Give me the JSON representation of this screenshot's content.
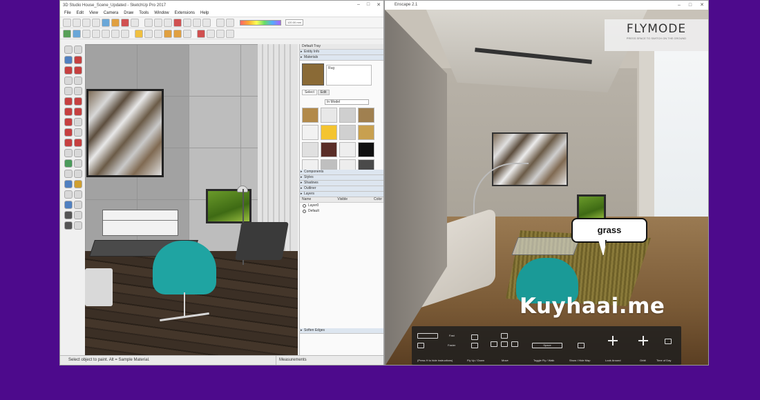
{
  "sketchup": {
    "title": "3D Studio House_Scene_Updated - SketchUp Pro 2017",
    "menu": [
      "File",
      "Edit",
      "View",
      "Camera",
      "Draw",
      "Tools",
      "Window",
      "Extensions",
      "Help"
    ],
    "field_label": "120.00 mm",
    "tray": {
      "title": "Default Tray",
      "entity_info": "Entity Info",
      "materials": "Materials",
      "material_name": "Rug",
      "tabs": [
        "Select",
        "Edit"
      ],
      "category": "In Model",
      "swatch_colors": [
        "#b28a4a",
        "#e8e8e8",
        "#cfcfcf",
        "#a08050",
        "#f2f2f2",
        "#f4c430",
        "#d0d0d0",
        "#c8a050",
        "#e0e0e0",
        "#5a2e28",
        "#eeeeee",
        "#111111",
        "#f0f0f0",
        "#bfbfbf",
        "#ededed",
        "#4a4a4a"
      ],
      "sections": [
        "Components",
        "Styles",
        "Shadows",
        "Outliner",
        "Layers"
      ],
      "layers_header": [
        "Name",
        "Visible",
        "Color"
      ],
      "layers": [
        "Layer0",
        "Default"
      ],
      "soften_edges": "Soften Edges"
    },
    "status": {
      "text": "Select object to paint. Alt = Sample Material.",
      "measurements": "Measurements"
    }
  },
  "render": {
    "window_title": "Enscape 2.1",
    "flymode": {
      "title": "FLYMODE",
      "subtitle": "PRESS SPACE TO SWITCH ON THE GROUND"
    },
    "tooltip": "grass",
    "controls": {
      "fast": "Fast",
      "faster": "Faster",
      "info": "(Press H to hide instructions)",
      "fly": "Fly Up / Down",
      "move": "Move",
      "toggle": "Toggle Fly / Walk",
      "space": "Space",
      "minimap": "Show / Hide Map",
      "look": "Look Around",
      "orbit": "Orbit",
      "timeofday": "Time of Day"
    }
  },
  "watermark": "Kuyhaai.me",
  "colors": {
    "background": "#4d0a8c",
    "chair_teal": "#1fa4a2"
  }
}
